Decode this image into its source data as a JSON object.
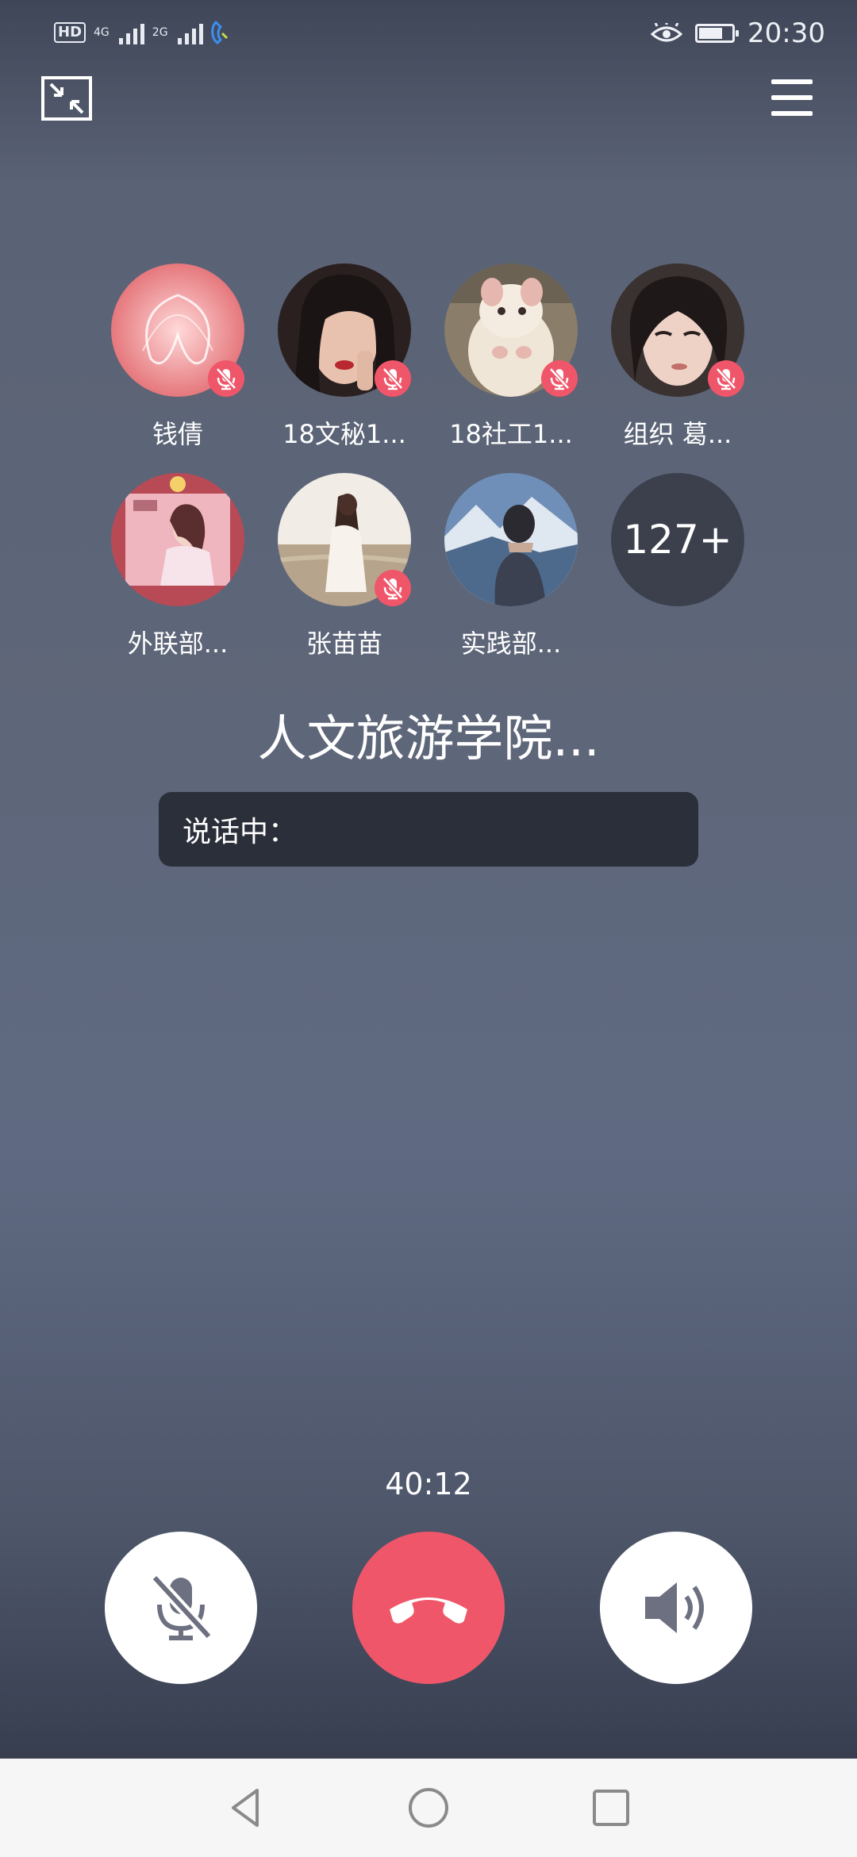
{
  "status_bar": {
    "hd_label": "HD",
    "sim1_network": "4G",
    "sim2_network": "2G",
    "time": "20:30",
    "battery_level": 0.72,
    "icons": [
      "hd-volte-icon",
      "signal-icon",
      "signal-icon",
      "call-indicator-icon",
      "eye-comfort-icon",
      "battery-icon"
    ]
  },
  "top_bar": {
    "icons": [
      "minimize-window-icon",
      "menu-icon"
    ]
  },
  "members": [
    {
      "name": "钱倩",
      "muted": true,
      "avatar": "pink-abstract"
    },
    {
      "name": "18文秘1...",
      "muted": true,
      "avatar": "woman-portrait"
    },
    {
      "name": "18社工1...",
      "muted": true,
      "avatar": "hamster"
    },
    {
      "name": "组织 葛...",
      "muted": true,
      "avatar": "girl-portrait"
    },
    {
      "name": "外联部...",
      "muted": false,
      "avatar": "pink-poster"
    },
    {
      "name": "张苗苗",
      "muted": true,
      "avatar": "girl-beach"
    },
    {
      "name": "实践部...",
      "muted": false,
      "avatar": "man-mountains"
    }
  ],
  "more_count": "127+",
  "group_title": "人文旅游学院...",
  "speaking_label": "说话中：",
  "call_timer": "40:12",
  "controls": {
    "icons": [
      "mic-off-icon",
      "hang-up-icon",
      "speaker-icon"
    ]
  },
  "colors": {
    "accent_red": "#f0566a",
    "speaking_bg": "#2b2f39"
  },
  "nav": {
    "icons": [
      "back-icon",
      "home-icon",
      "recent-apps-icon"
    ]
  }
}
